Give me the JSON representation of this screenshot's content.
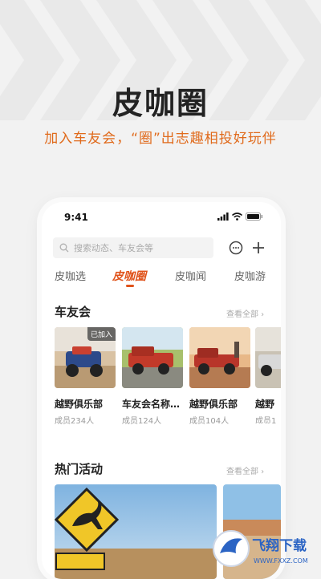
{
  "promo": {
    "title": "皮咖圈",
    "subtitle": "加入车友会，“圈”出志趣相投好玩伴"
  },
  "status_bar": {
    "time": "9:41"
  },
  "search": {
    "placeholder": "搜索动态、车友会等"
  },
  "tabs": [
    {
      "label": "皮咖选",
      "active": false
    },
    {
      "label": "皮咖圈",
      "active": true
    },
    {
      "label": "皮咖闻",
      "active": false
    },
    {
      "label": "皮咖游",
      "active": false
    }
  ],
  "clubs_section": {
    "title": "车友会",
    "see_all": "查看全部 ›"
  },
  "clubs": [
    {
      "name": "越野俱乐部",
      "members": "成员234人",
      "badge": "已加入"
    },
    {
      "name": "车友会名称…",
      "members": "成员124人"
    },
    {
      "name": "越野俱乐部",
      "members": "成员104人"
    },
    {
      "name": "越野",
      "members": "成员1"
    }
  ],
  "events_section": {
    "title": "热门活动",
    "see_all": "查看全部 ›"
  },
  "watermark": {
    "text": "飞翔下载",
    "url_text": "WWW.FXXZ.COM"
  },
  "colors": {
    "accent": "#e0531b",
    "subtitle": "#e06a1b"
  }
}
